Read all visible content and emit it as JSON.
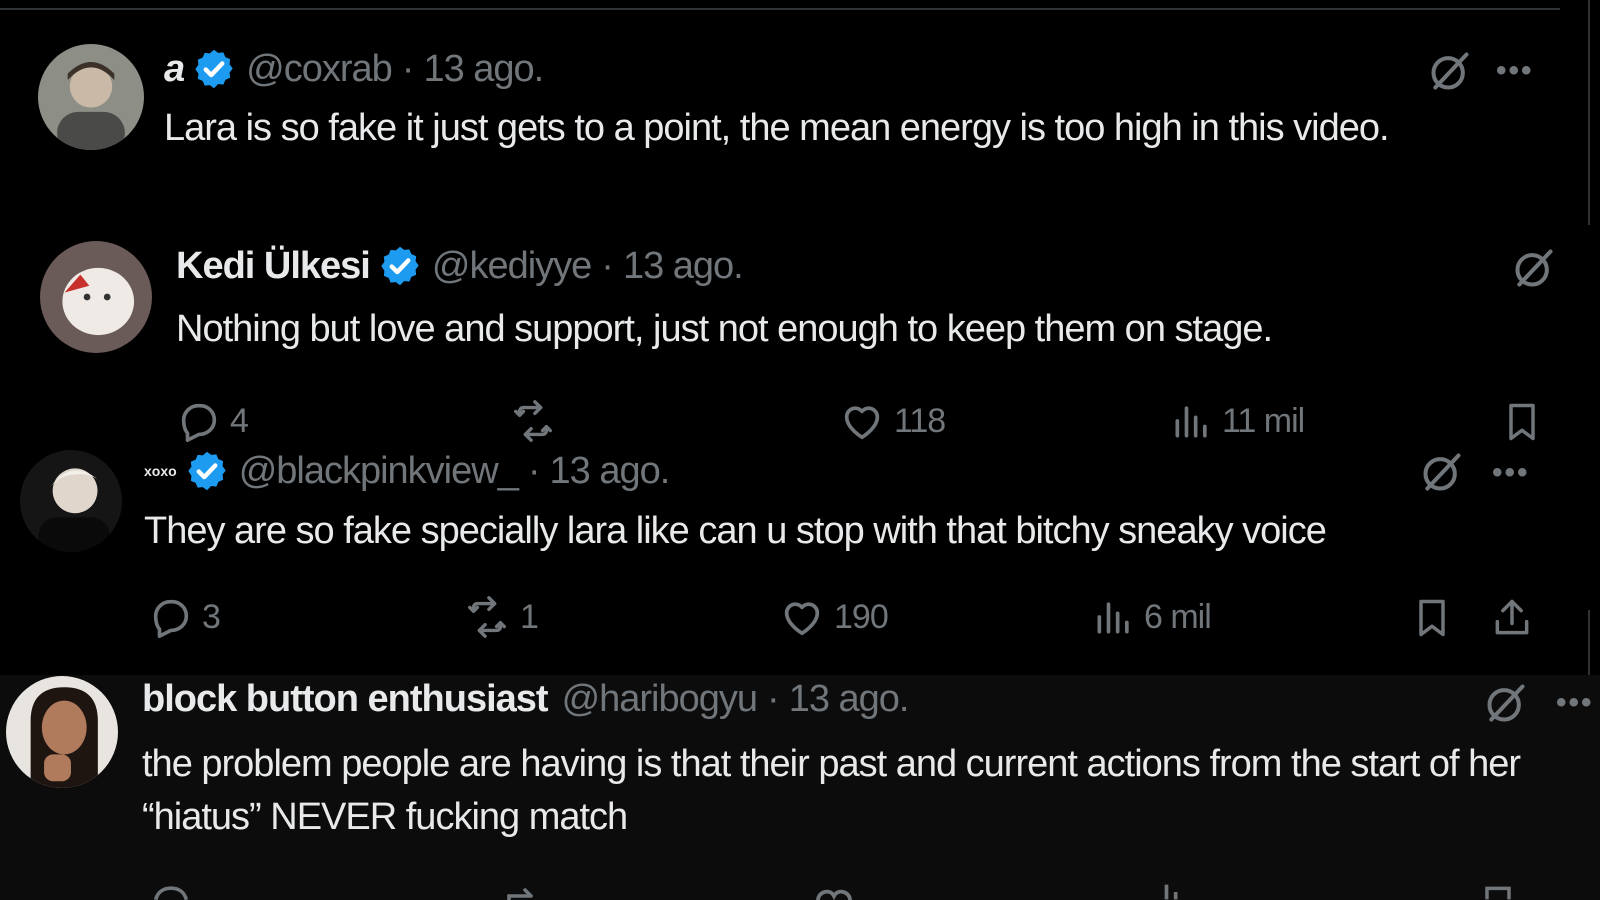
{
  "replies": [
    {
      "display_name": "a",
      "verified": true,
      "handle": "@coxrab",
      "separator": "·",
      "time": "13 ago.",
      "text": "Lara is so fake it just gets to a point, the mean energy is too high in this video."
    },
    {
      "display_name": "Kedi Ülkesi",
      "verified": true,
      "handle": "@kediyye",
      "separator": "·",
      "time": "13 ago.",
      "text": "Nothing but love and support, just not enough to keep them on stage.",
      "actions": {
        "replies": "4",
        "reposts": "",
        "likes": "118",
        "views": "11 mil"
      }
    },
    {
      "display_name": "xoxo",
      "verified": true,
      "handle": "@blackpinkview_",
      "separator": "·",
      "time": "13 ago.",
      "text": "They are so fake specially lara like can u stop with that bitchy sneaky voice",
      "actions": {
        "replies": "3",
        "reposts": "1",
        "likes": "190",
        "views": "6 mil"
      }
    },
    {
      "display_name": "block button enthusiast",
      "verified": false,
      "handle": "@haribogyu",
      "separator": "·",
      "time": "13 ago.",
      "text": "the problem people are having is that their past and current actions from the start of her “hiatus” NEVER fucking match"
    }
  ],
  "icons": {
    "grok": "grok-slash-circle-icon",
    "more": "more-dots-icon",
    "reply": "speech-bubble-icon",
    "repost": "repost-arrows-icon",
    "like": "heart-icon",
    "views": "bar-chart-icon",
    "bookmark": "bookmark-icon",
    "share": "share-upload-icon"
  },
  "colors": {
    "background": "#000000",
    "text": "#e7e9ea",
    "muted": "#71767b",
    "verified": "#1d9bf0"
  }
}
